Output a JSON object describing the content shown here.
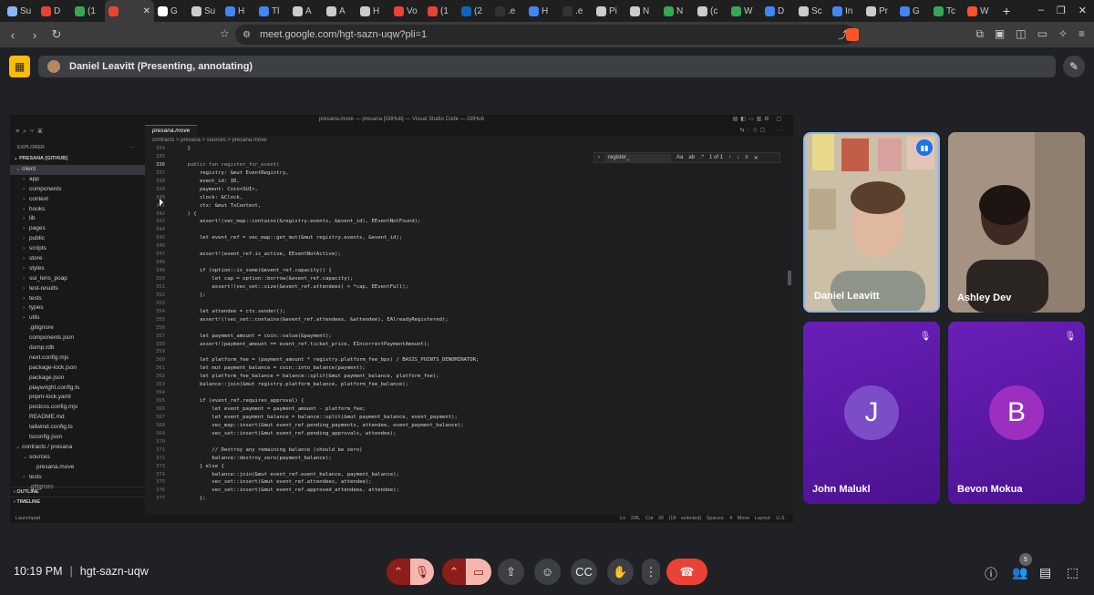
{
  "browser": {
    "tabs": [
      {
        "label": "Su",
        "color": "#8ab4f8"
      },
      {
        "label": "D",
        "color": "#ea4335"
      },
      {
        "label": "(1",
        "color": "#34a853"
      },
      {
        "label": "",
        "color": "#ea4335",
        "active": true
      },
      {
        "label": "G",
        "color": "#ffffff"
      },
      {
        "label": "Su",
        "color": "#cccccc"
      },
      {
        "label": "H",
        "color": "#4285f4"
      },
      {
        "label": "Tl",
        "color": "#4285f4"
      },
      {
        "label": "A",
        "color": "#cccccc"
      },
      {
        "label": "A",
        "color": "#cccccc"
      },
      {
        "label": "H",
        "color": "#cccccc"
      },
      {
        "label": "Vo",
        "color": "#ea4335"
      },
      {
        "label": "(1",
        "color": "#ea4335"
      },
      {
        "label": "(2",
        "color": "#0a66c2"
      },
      {
        "label": ".e",
        "color": "#333333"
      },
      {
        "label": "H",
        "color": "#4285f4"
      },
      {
        "label": ".e",
        "color": "#333333"
      },
      {
        "label": "Pi",
        "color": "#cccccc"
      },
      {
        "label": "N",
        "color": "#cccccc"
      },
      {
        "label": "N",
        "color": "#34a853"
      },
      {
        "label": "(c",
        "color": "#cccccc"
      },
      {
        "label": "W",
        "color": "#34a853"
      },
      {
        "label": "D",
        "color": "#4285f4"
      },
      {
        "label": "Sc",
        "color": "#cccccc"
      },
      {
        "label": "In",
        "color": "#4285f4"
      },
      {
        "label": "Pr",
        "color": "#cccccc"
      },
      {
        "label": "G",
        "color": "#4285f4"
      },
      {
        "label": "Tc",
        "color": "#34a853"
      },
      {
        "label": "W",
        "color": "#fb542b"
      }
    ],
    "url": "meet.google.com/hgt-sazn-uqw?pli=1"
  },
  "presenting": {
    "text": "Daniel Leavitt (Presenting, annotating)"
  },
  "vscode": {
    "title": "presana.move — presana [GitHub] — Visual Studio Code — GitHub",
    "explorer_label": "EXPLORER",
    "repo_label": "PRESANA [GITHUB]",
    "tree": [
      {
        "name": "client",
        "depth": 0,
        "open": true,
        "folder": true,
        "selected": true
      },
      {
        "name": "app",
        "depth": 1,
        "folder": true
      },
      {
        "name": "components",
        "depth": 1,
        "folder": true
      },
      {
        "name": "context",
        "depth": 1,
        "folder": true
      },
      {
        "name": "hooks",
        "depth": 1,
        "folder": true
      },
      {
        "name": "lib",
        "depth": 1,
        "folder": true
      },
      {
        "name": "pages",
        "depth": 1,
        "folder": true
      },
      {
        "name": "public",
        "depth": 1,
        "folder": true
      },
      {
        "name": "scripts",
        "depth": 1,
        "folder": true
      },
      {
        "name": "store",
        "depth": 1,
        "folder": true
      },
      {
        "name": "styles",
        "depth": 1,
        "folder": true
      },
      {
        "name": "sui_lens_poap",
        "depth": 1,
        "folder": true
      },
      {
        "name": "test-results",
        "depth": 1,
        "folder": true
      },
      {
        "name": "tests",
        "depth": 1,
        "folder": true
      },
      {
        "name": "types",
        "depth": 1,
        "folder": true
      },
      {
        "name": "utils",
        "depth": 1,
        "folder": true
      },
      {
        "name": ".gitignore",
        "depth": 1
      },
      {
        "name": "components.json",
        "depth": 1
      },
      {
        "name": "dump.rdb",
        "depth": 1
      },
      {
        "name": "next.config.mjs",
        "depth": 1
      },
      {
        "name": "package-lock.json",
        "depth": 1
      },
      {
        "name": "package.json",
        "depth": 1
      },
      {
        "name": "playwright.config.ts",
        "depth": 1
      },
      {
        "name": "pnpm-lock.yaml",
        "depth": 1
      },
      {
        "name": "postcss.config.mjs",
        "depth": 1
      },
      {
        "name": "README.md",
        "depth": 1
      },
      {
        "name": "tailwind.config.ts",
        "depth": 1
      },
      {
        "name": "tsconfig.json",
        "depth": 1
      },
      {
        "name": "contracts / presana",
        "depth": 0,
        "open": true,
        "folder": true
      },
      {
        "name": "sources",
        "depth": 1,
        "open": true,
        "folder": true
      },
      {
        "name": "presana.move",
        "depth": 2
      },
      {
        "name": "tests",
        "depth": 1,
        "folder": true
      },
      {
        "name": ".gitignore",
        "depth": 1
      }
    ],
    "outline_label": "OUTLINE",
    "timeline_label": "TIMELINE",
    "tab_label": "presana.move",
    "breadcrumb": "contracts > presana > sources > presana.move",
    "find_query": "register_",
    "find_count": "1 of 1",
    "find_aa": "Aa",
    "code": [
      {
        "n": "334",
        "t": "    }"
      },
      {
        "n": "335",
        "t": ""
      },
      {
        "n": "336",
        "t": "    public fun register_for_event(",
        "cur": true
      },
      {
        "n": "337",
        "t": "        registry: &mut EventRegistry,"
      },
      {
        "n": "338",
        "t": "        event_id: ID,"
      },
      {
        "n": "339",
        "t": "        payment: Coin<SUI>,"
      },
      {
        "n": "340",
        "t": "        clock: &Clock,"
      },
      {
        "n": "341",
        "t": "        ctx: &mut TxContext,"
      },
      {
        "n": "342",
        "t": "    ) {"
      },
      {
        "n": "343",
        "t": "        assert!(vec_map::contains(&registry.events, &event_id), EEventNotFound);"
      },
      {
        "n": "344",
        "t": ""
      },
      {
        "n": "345",
        "t": "        let event_ref = vec_map::get_mut(&mut registry.events, &event_id);"
      },
      {
        "n": "346",
        "t": ""
      },
      {
        "n": "347",
        "t": "        assert!(event_ref.is_active, EEventNotActive);"
      },
      {
        "n": "348",
        "t": ""
      },
      {
        "n": "349",
        "t": "        if (option::is_some(&event_ref.capacity)) {"
      },
      {
        "n": "350",
        "t": "            let cap = option::borrow(&event_ref.capacity);"
      },
      {
        "n": "351",
        "t": "            assert!(vec_set::size(&event_ref.attendees) < *cap, EEventFull);"
      },
      {
        "n": "352",
        "t": "        };"
      },
      {
        "n": "353",
        "t": ""
      },
      {
        "n": "354",
        "t": "        let attendee = ctx.sender();"
      },
      {
        "n": "355",
        "t": "        assert!(!vec_set::contains(&event_ref.attendees, &attendee), EAlreadyRegistered);"
      },
      {
        "n": "356",
        "t": ""
      },
      {
        "n": "357",
        "t": "        let payment_amount = coin::value(&payment);"
      },
      {
        "n": "358",
        "t": "        assert!(payment_amount == event_ref.ticket_price, EIncorrectPaymentAmount);"
      },
      {
        "n": "359",
        "t": ""
      },
      {
        "n": "360",
        "t": "        let platform_fee = (payment_amount * registry.platform_fee_bps) / BASIS_POINTS_DENOMINATOR;"
      },
      {
        "n": "361",
        "t": "        let mut payment_balance = coin::into_balance(payment);"
      },
      {
        "n": "362",
        "t": "        let platform_fee_balance = balance::split(&mut payment_balance, platform_fee);"
      },
      {
        "n": "363",
        "t": "        balance::join(&mut registry.platform_balance, platform_fee_balance);"
      },
      {
        "n": "364",
        "t": ""
      },
      {
        "n": "365",
        "t": "        if (event_ref.requires_approval) {"
      },
      {
        "n": "366",
        "t": "            let event_payment = payment_amount - platform_fee;"
      },
      {
        "n": "367",
        "t": "            let event_payment_balance = balance::split(&mut payment_balance, event_payment);"
      },
      {
        "n": "368",
        "t": "            vec_map::insert(&mut event_ref.pending_payments, attendee, event_payment_balance);"
      },
      {
        "n": "369",
        "t": "            vec_set::insert(&mut event_ref.pending_approvals, attendee);"
      },
      {
        "n": "370",
        "t": ""
      },
      {
        "n": "371",
        "t": "            // Destroy any remaining balance (should be zero)"
      },
      {
        "n": "372",
        "t": "            balance::destroy_zero(payment_balance);"
      },
      {
        "n": "373",
        "t": "        } else {"
      },
      {
        "n": "374",
        "t": "            balance::join(&mut event_ref.event_balance, payment_balance);"
      },
      {
        "n": "375",
        "t": "            vec_set::insert(&mut event_ref.attendees, attendee);"
      },
      {
        "n": "376",
        "t": "            vec_set::insert(&mut event_ref.approved_attendees, attendee);"
      },
      {
        "n": "377",
        "t": "        };"
      }
    ],
    "status_left": "Launchpad",
    "status_right": "Ln 336, Col 30 (18 selected)   Spaces: 4   Move   Layout: U.S."
  },
  "participants": {
    "daniel": "Daniel Leavitt",
    "ashley": "Ashley Dev",
    "john": "John Malukl",
    "john_initial": "J",
    "bevon": "Bevon Mokua",
    "bevon_initial": "B",
    "count": "5"
  },
  "meeting": {
    "time": "10:19 PM",
    "separator": "|",
    "code": "hgt-sazn-uqw"
  }
}
